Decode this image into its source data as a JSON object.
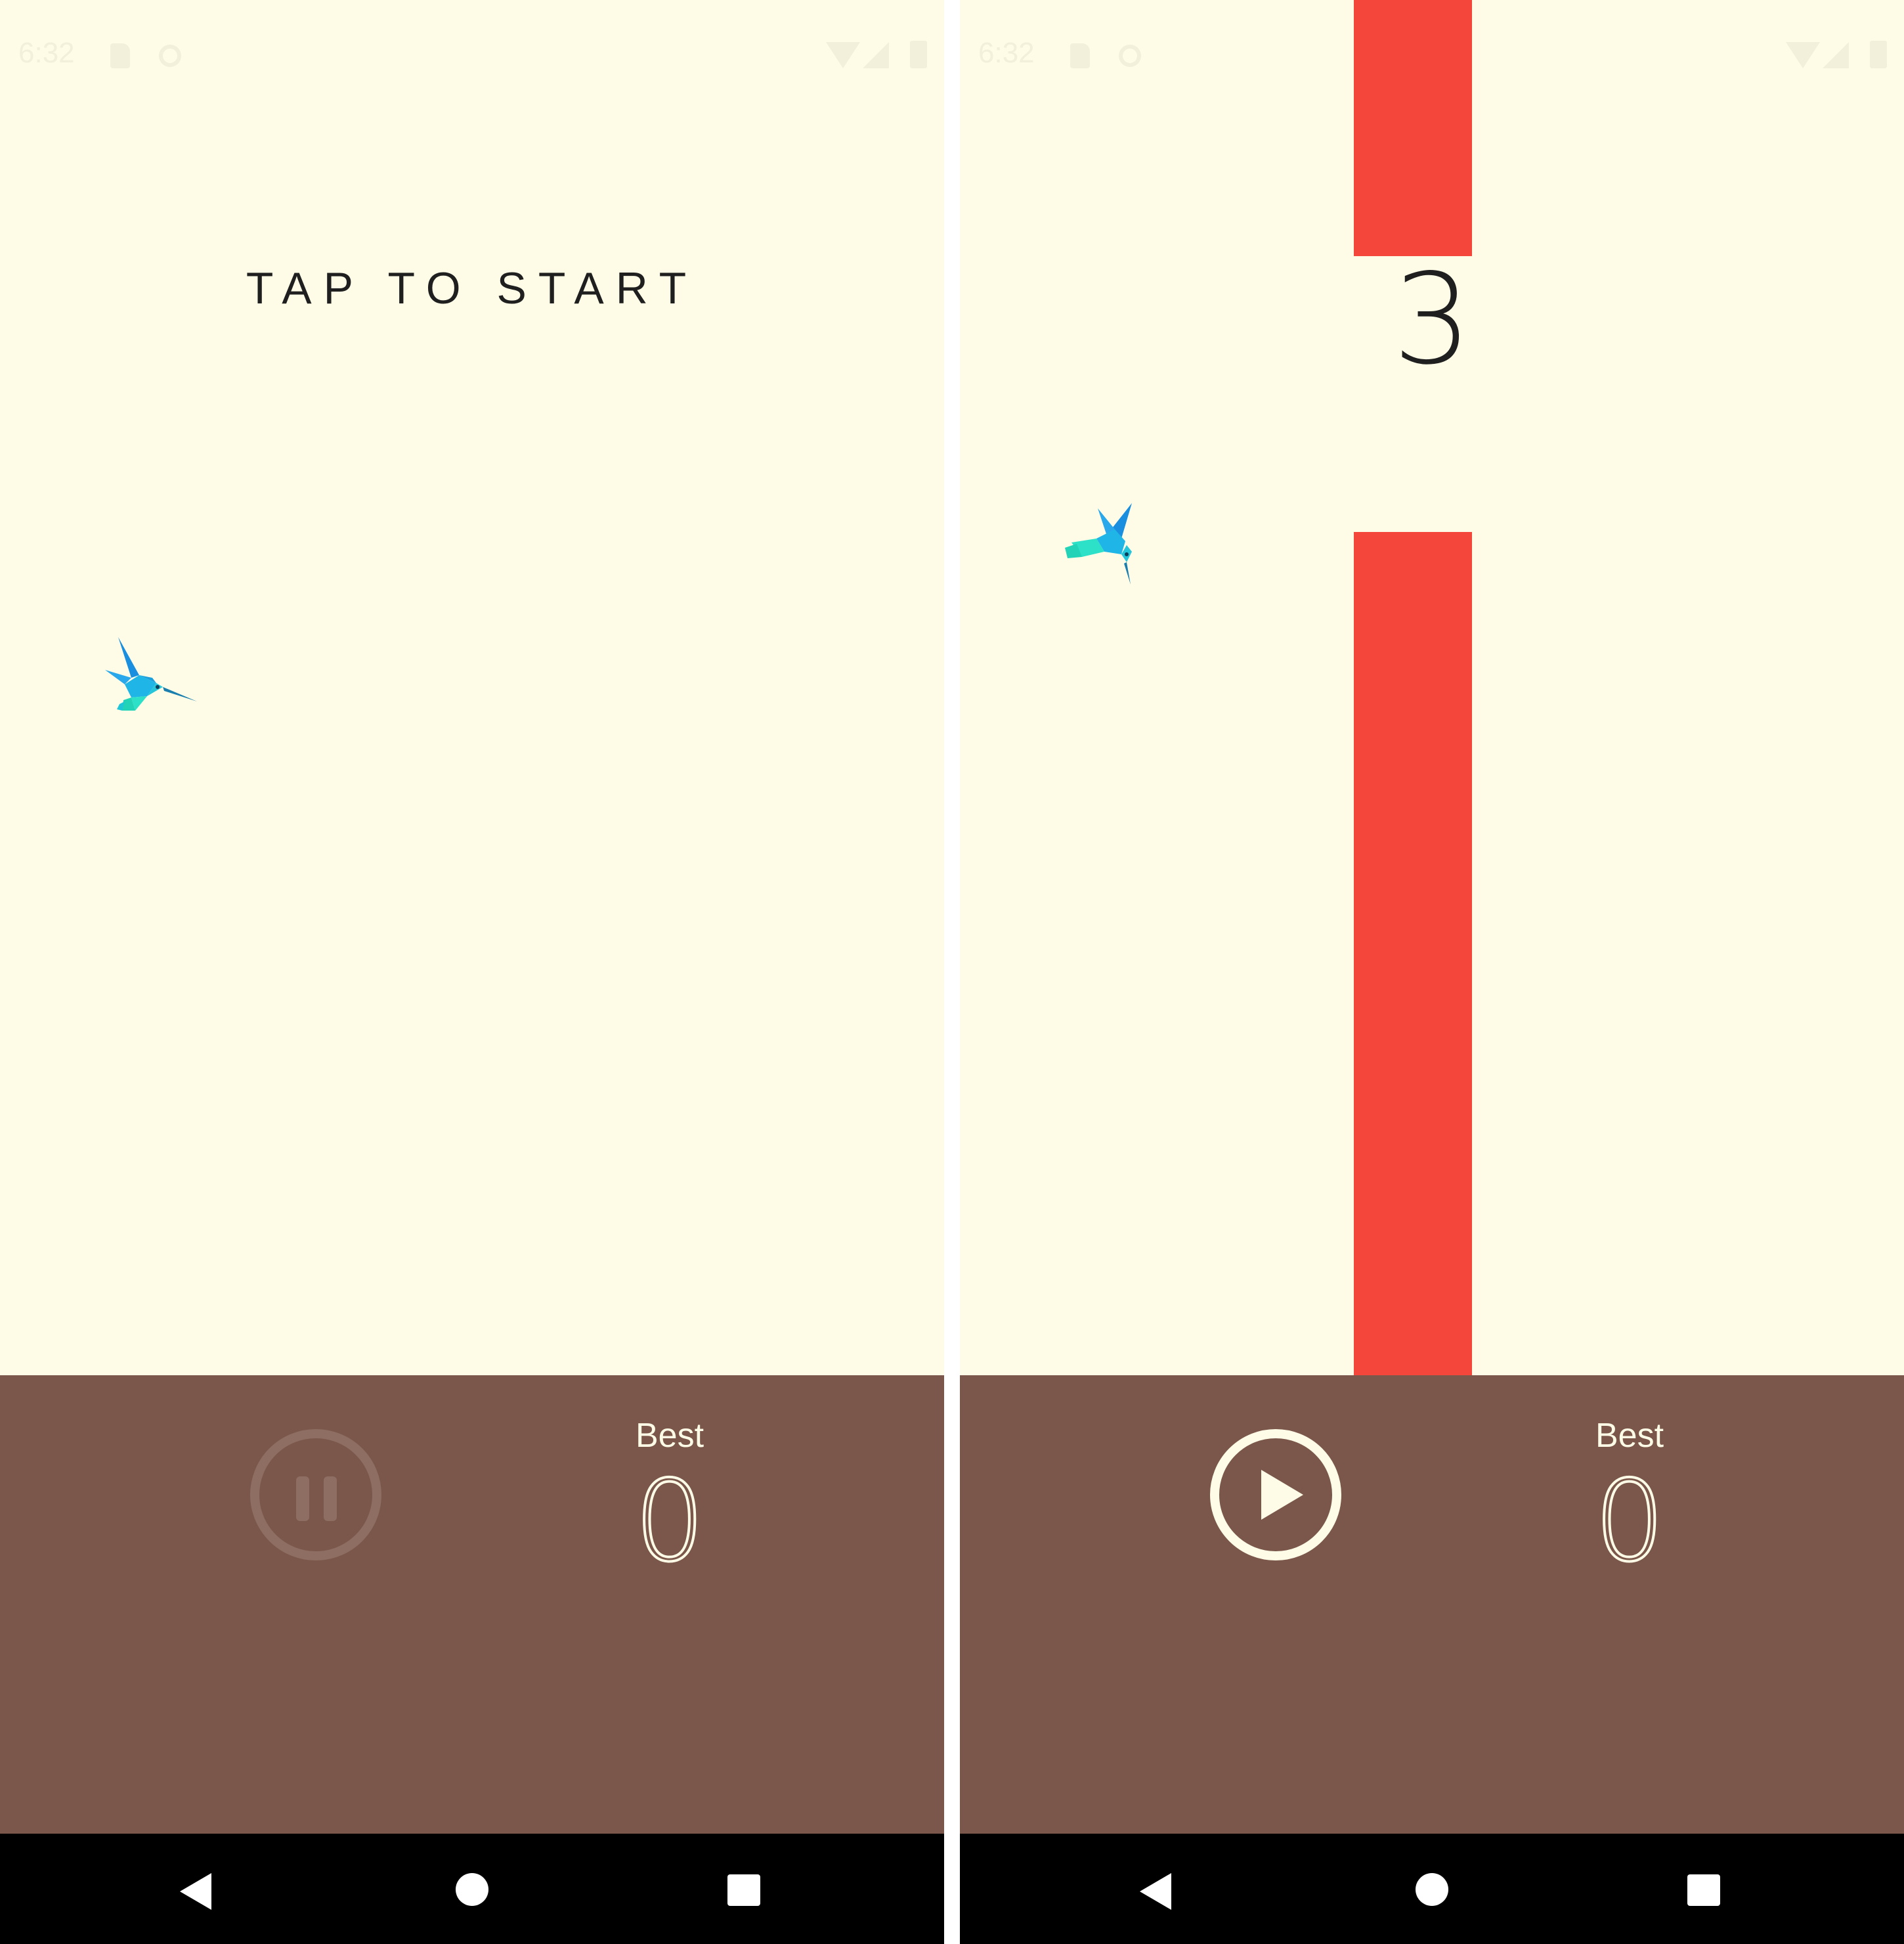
{
  "status_bar": {
    "time": "6:32",
    "left_icons": [
      "sd-card-icon",
      "sync-icon"
    ],
    "right_icons": [
      "wifi-icon",
      "signal-icon",
      "battery-icon"
    ]
  },
  "left_screen": {
    "prompt": "TAP TO START",
    "control_button": "pause-icon",
    "best_label": "Best",
    "best_value": "0"
  },
  "right_screen": {
    "score": "3",
    "control_button": "play-icon",
    "best_label": "Best",
    "best_value": "0"
  },
  "navigation": [
    "back-icon",
    "home-icon",
    "recents-icon"
  ],
  "colors": {
    "sky": "#fefce6",
    "pipe": "#f4463a",
    "ground": "#7a574a",
    "bird_blue": "#1fa3e8",
    "bird_teal": "#2dd4c4",
    "nav_bar": "#000000"
  }
}
